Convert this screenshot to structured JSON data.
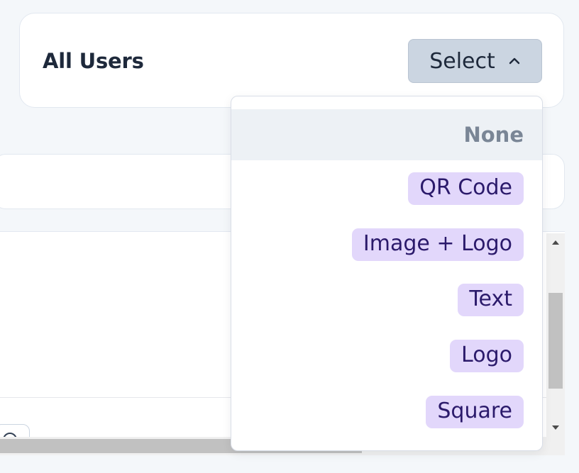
{
  "header": {
    "title": "All Users",
    "select_label": "Select"
  },
  "dropdown": {
    "none_label": "None",
    "options": [
      {
        "label": "QR Code"
      },
      {
        "label": "Image + Logo"
      },
      {
        "label": "Text"
      },
      {
        "label": "Logo"
      },
      {
        "label": "Square"
      }
    ]
  },
  "icons": {
    "select_toggle": "chevron-up-icon",
    "scroll_up": "arrow-up-icon",
    "scroll_down": "arrow-down-icon"
  },
  "colors": {
    "page_bg": "#f4f7fa",
    "select_bg": "#cbd5e1",
    "chip_bg": "#e2d7fb",
    "chip_text": "#2b1a6b",
    "none_row_bg": "#edf1f5"
  }
}
